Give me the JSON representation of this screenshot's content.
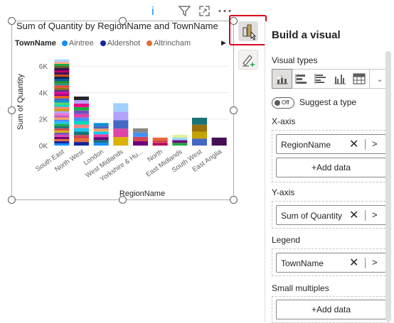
{
  "visual": {
    "title": "Sum of Quantity by RegionName and TownName",
    "legend": {
      "title": "TownName",
      "items": [
        {
          "label": "Aintree",
          "color": "#118dff"
        },
        {
          "label": "Aldershot",
          "color": "#12239e"
        },
        {
          "label": "Altrincham",
          "color": "#e66c37"
        }
      ]
    },
    "toolbar_icons": [
      "info-icon",
      "filter-icon",
      "focus-mode-icon",
      "more-options-icon"
    ]
  },
  "chart_data": {
    "type": "bar",
    "stacked": true,
    "xlabel": "RegionName",
    "ylabel": "Sum of Quantity",
    "y_ticks": [
      "0K",
      "2K",
      "4K",
      "6K"
    ],
    "ylim": [
      0,
      6600
    ],
    "categories": [
      "South East",
      "North West",
      "London",
      "West Midlands",
      "Yorkshire & Hu...",
      "North",
      "East Midlands",
      "South West",
      "East Anglia"
    ],
    "totals": [
      6500,
      3700,
      1700,
      3200,
      1300,
      600,
      800,
      2100,
      600
    ],
    "stack_colors": [
      [
        "#118dff",
        "#12239e",
        "#e66c37",
        "#6b007b",
        "#e044a7",
        "#744ec2",
        "#d9b300",
        "#d64550",
        "#197278",
        "#1aab40",
        "#15c6f4",
        "#4092ff",
        "#ffa058",
        "#be5dc9",
        "#f472d0",
        "#b5a1ff",
        "#c4a200",
        "#ff8080",
        "#00dbbc",
        "#5bd667",
        "#0091d5",
        "#4668c5",
        "#ff6300",
        "#99008a",
        "#ec008c",
        "#533285",
        "#99700a",
        "#ff4141",
        "#1f9a85",
        "#25891c",
        "#0057a2",
        "#002050",
        "#c94f0f",
        "#450f54",
        "#b60064",
        "#34124f",
        "#6a5a29",
        "#1aab40",
        "#fdab89",
        "#a0d1ff"
      ],
      [
        "#12239e",
        "#e66c37",
        "#d64550",
        "#197278",
        "#15c6f4",
        "#ff8080",
        "#00dbbc",
        "#4092ff",
        "#e044a7",
        "#744ec2",
        "#1aab40",
        "#ec008c",
        "#b5a1ff",
        "#252423"
      ],
      [
        "#118dff",
        "#197278",
        "#6b007b",
        "#e044a7",
        "#15c6f4",
        "#ffa058",
        "#4668c5",
        "#0091d5"
      ],
      [
        "#d9b300",
        "#e044a7",
        "#4668c5",
        "#b5a1ff",
        "#a0d1ff"
      ],
      [
        "#6b007b",
        "#d64550",
        "#4092ff",
        "#8a8886"
      ],
      [
        "#b60064",
        "#d64550",
        "#e66c37"
      ],
      [
        "#1aab40",
        "#6b007b",
        "#a0d1ff",
        "#d9f58a"
      ],
      [
        "#4668c5",
        "#c4a200",
        "#99700a",
        "#197278"
      ],
      [
        "#450f54"
      ]
    ]
  },
  "side_buttons": {
    "build": "build-visual-icon",
    "format": "format-visual-icon"
  },
  "pane": {
    "title": "Build a visual",
    "visual_types_label": "Visual types",
    "visual_types": [
      "stacked-column-chart-icon",
      "stacked-bar-chart-icon",
      "clustered-bar-chart-icon",
      "clustered-column-chart-icon",
      "table-icon"
    ],
    "suggest": {
      "toggle_text": "Off",
      "label": "Suggest a type"
    },
    "wells": [
      {
        "label": "X-axis",
        "field": "RegionName",
        "add": "+Add data"
      },
      {
        "label": "Y-axis",
        "field": "Sum of Quantity"
      },
      {
        "label": "Legend",
        "field": "TownName"
      },
      {
        "label": "Small multiples",
        "add": "+Add data"
      }
    ]
  }
}
